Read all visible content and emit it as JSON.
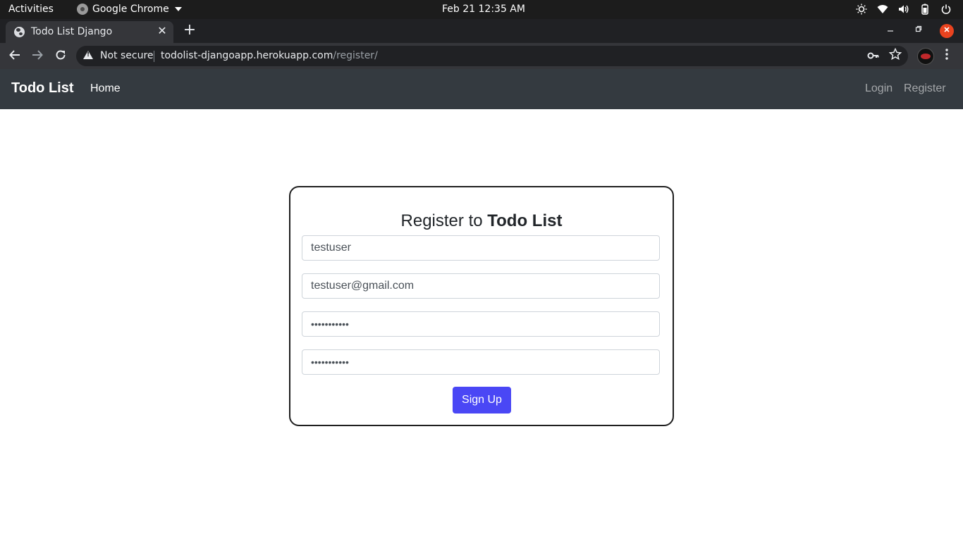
{
  "os": {
    "activities": "Activities",
    "app_name": "Google Chrome",
    "clock": "Feb 21  12:35 AM",
    "tray_icons": [
      "brightness-icon",
      "wifi-icon",
      "volume-icon",
      "battery-icon",
      "power-icon"
    ]
  },
  "browser": {
    "tab_title": "Todo List Django",
    "tab_close": "✕",
    "new_tab": "+",
    "security_label": "Not secure",
    "url_host": "todolist-djangoapp.herokuapp.com",
    "url_path": "/register/"
  },
  "navbar": {
    "brand": "Todo List",
    "home": "Home",
    "login": "Login",
    "register": "Register"
  },
  "form": {
    "title_prefix": "Register to ",
    "title_bold": "Todo List",
    "username": "testuser",
    "email": "testuser@gmail.com",
    "password1": "•••••••••••",
    "password2": "•••••••••••",
    "submit": "Sign Up"
  },
  "colors": {
    "navbar_bg": "#343a40",
    "button_bg": "#4a47f5",
    "close_button": "#e9431f"
  }
}
